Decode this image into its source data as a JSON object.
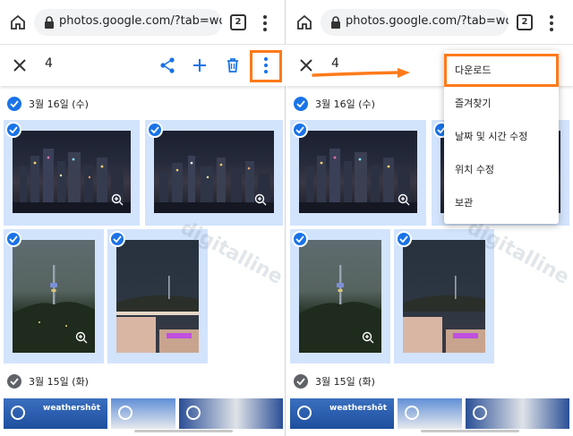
{
  "browser": {
    "url": "photos.google.com/?tab=wq&p",
    "tab_count": "2"
  },
  "selection": {
    "count": "4"
  },
  "groups": [
    {
      "date": "3월 16일 (수)"
    },
    {
      "date": "3월 15일 (화)"
    }
  ],
  "bottom": {
    "weather_label": "weathershōt"
  },
  "menu": {
    "items": [
      {
        "label": "다운로드"
      },
      {
        "label": "즐겨찾기"
      },
      {
        "label": "날짜 및 시간 수정"
      },
      {
        "label": "위치 수정"
      },
      {
        "label": "보관"
      }
    ]
  },
  "watermark": "digitalline",
  "colors": {
    "accent_blue": "#1a73e8",
    "highlight_orange": "#ff7a1a",
    "tile_selected_bg": "#d2e3fc"
  },
  "icons": [
    "home-icon",
    "lock-icon",
    "tab-switcher-icon",
    "browser-menu-icon",
    "close-icon",
    "share-icon",
    "add-icon",
    "trash-icon",
    "more-vert-icon",
    "check-icon",
    "zoom-icon"
  ]
}
